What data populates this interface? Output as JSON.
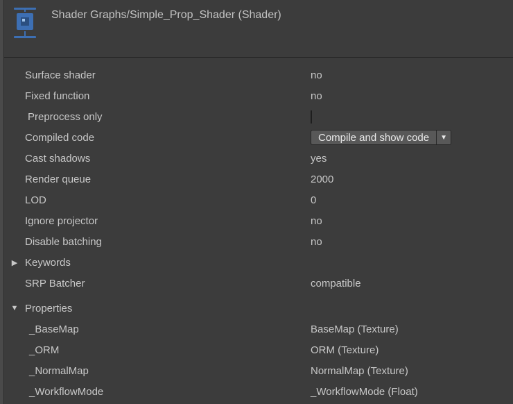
{
  "header": {
    "title": "Shader Graphs/Simple_Prop_Shader (Shader)",
    "icon": "shader-icon"
  },
  "info": {
    "surface_shader": {
      "label": "Surface shader",
      "value": "no"
    },
    "fixed_function": {
      "label": "Fixed function",
      "value": "no"
    },
    "preprocess_only": {
      "label": "Preprocess only",
      "checked": false
    },
    "compiled_code": {
      "label": "Compiled code",
      "button": "Compile and show code"
    },
    "cast_shadows": {
      "label": "Cast shadows",
      "value": "yes"
    },
    "render_queue": {
      "label": "Render queue",
      "value": "2000"
    },
    "lod": {
      "label": "LOD",
      "value": "0"
    },
    "ignore_projector": {
      "label": "Ignore projector",
      "value": "no"
    },
    "disable_batching": {
      "label": "Disable batching",
      "value": "no"
    },
    "keywords": {
      "label": "Keywords",
      "expanded": false
    },
    "srp_batcher": {
      "label": "SRP Batcher",
      "value": "compatible"
    }
  },
  "properties": {
    "header": "Properties",
    "expanded": true,
    "items": [
      {
        "name": "_BaseMap",
        "desc": "BaseMap (Texture)"
      },
      {
        "name": "_ORM",
        "desc": "ORM (Texture)"
      },
      {
        "name": "_NormalMap",
        "desc": "NormalMap (Texture)"
      },
      {
        "name": "_WorkflowMode",
        "desc": "_WorkflowMode (Float)"
      }
    ]
  }
}
